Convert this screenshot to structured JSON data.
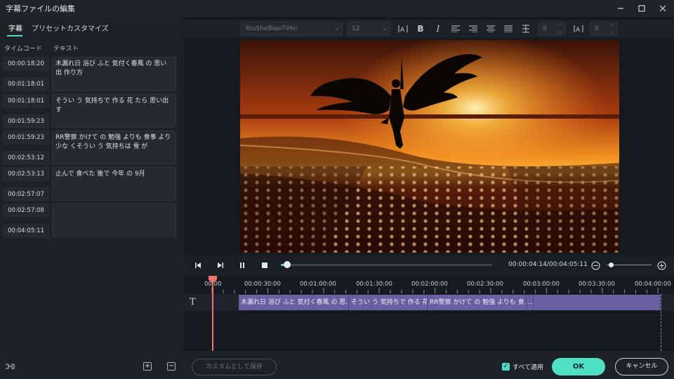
{
  "window": {
    "title": "字幕ファイルの編集",
    "minimize_icon": "minimize-icon",
    "maximize_icon": "maximize-icon",
    "close_icon": "close-icon"
  },
  "left_panel": {
    "tabs": [
      {
        "label": "字幕",
        "active": true
      },
      {
        "label": "プリセット",
        "active": false
      },
      {
        "label": "カスタマイズ",
        "active": false
      }
    ],
    "columns": {
      "timecode": "タイムコード",
      "text": "テキスト"
    },
    "rows": [
      {
        "start": "00:00:18:20",
        "end": "00:01:18:01",
        "text": "木漏れ日 浴び ふと 気付く春風 の 思い出 作り方"
      },
      {
        "start": "00:01:18:01",
        "end": "00:01:59:23",
        "text": "そうい う 気持ちで 作る 花 たら 思い出す"
      },
      {
        "start": "00:01:59:23",
        "end": "00:02:53:12",
        "text": "RR警察 かけて の 勉強 よりも 食事 より 少な くそうい う 気持ちは 雪 が"
      },
      {
        "start": "00:02:53:13",
        "end": "00:02:57:07",
        "text": "止んで 食べた 後で 今年 の 9月"
      },
      {
        "start": "00:02:57:08",
        "end": "00:04:05:11",
        "text": ""
      }
    ]
  },
  "toolbar": {
    "font": "YouSheBiaoTiHei",
    "size": "12",
    "char_spacing": "0",
    "line_spacing": "0"
  },
  "player": {
    "timecode": "00:00:04:14/00:04:05:11",
    "progress": 0.02,
    "zoom": 0.05
  },
  "timeline": {
    "ruler": [
      "00:00",
      "00:00:30:00",
      "00:01:00:00",
      "00:01:30:00",
      "00:02:00:00",
      "00:02:30:00",
      "00:03:00:00",
      "00:03:30:00",
      "00:04:00:00"
    ],
    "clips": [
      "木漏れ日 浴び ふと 気付く春風 の 思...",
      "そうい う 気持ちで 作る 花...",
      "RR警察 かけて の 勉強 よりも 食...",
      "...",
      ""
    ]
  },
  "bottom": {
    "save_custom": "カスタムとして保存",
    "apply_all": "すべて適用",
    "apply_all_checked": true,
    "ok": "OK",
    "cancel": "キャンセル"
  },
  "colors": {
    "accent": "#4fe0c4",
    "clip": "#6a5fa3",
    "playhead": "#f0766a"
  }
}
